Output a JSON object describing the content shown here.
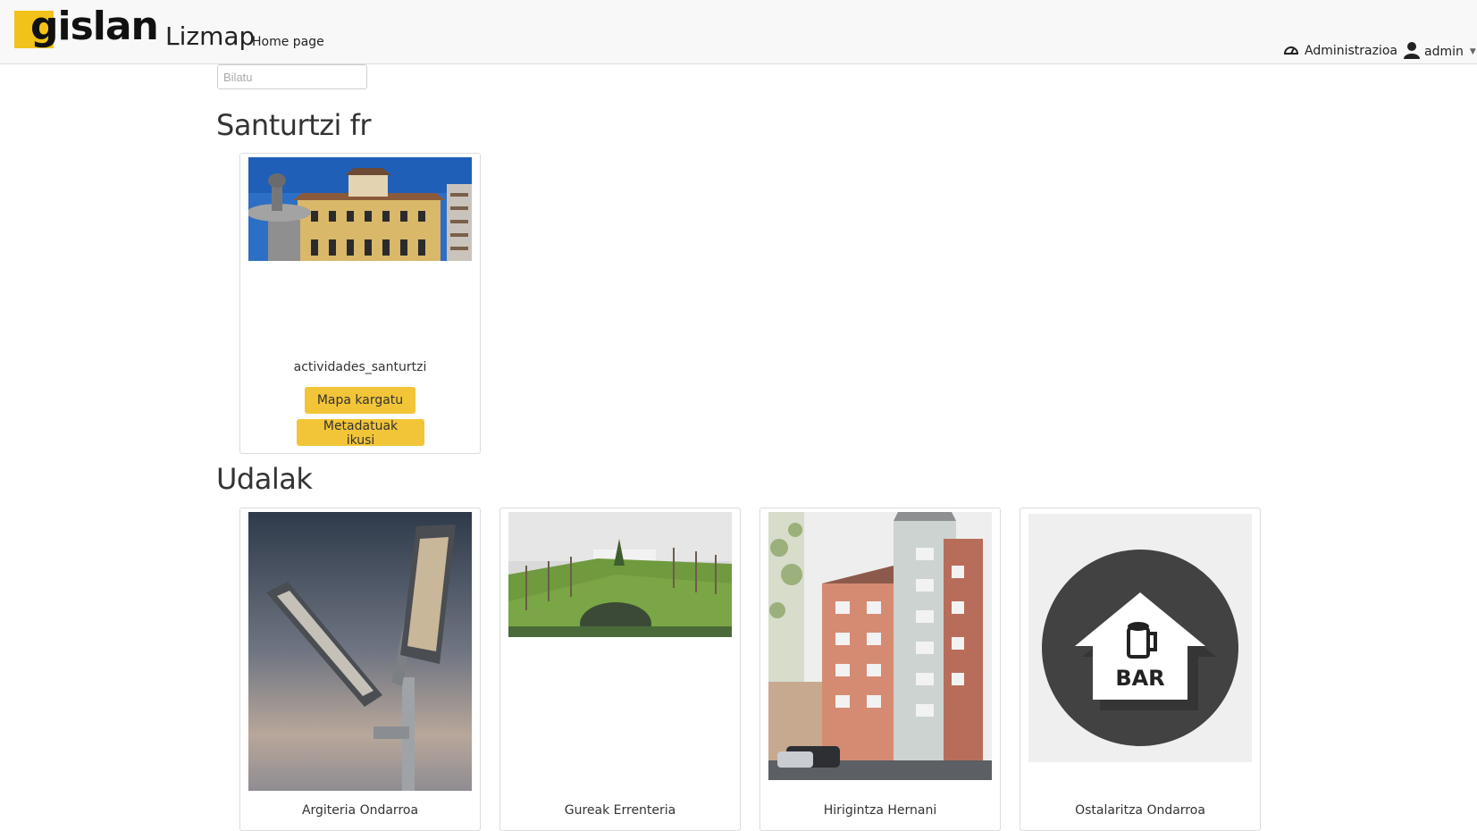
{
  "header": {
    "logo_text": "gislan",
    "app_title": "Lizmap",
    "home_link": "Home page",
    "admin_link": "Administrazioa",
    "user_name": "admin"
  },
  "search": {
    "placeholder": "Bilatu"
  },
  "sections": [
    {
      "title": "Santurtzi fr",
      "projects": [
        {
          "name": "actividades_santurtzi",
          "load_button": "Mapa kargatu",
          "metadata_button": "Metadatuak ikusi"
        }
      ]
    },
    {
      "title": "Udalak",
      "projects": [
        {
          "name": "Argiteria Ondarroa"
        },
        {
          "name": "Gureak Errenteria"
        },
        {
          "name": "Hirigintza Hernani"
        },
        {
          "name": "Ostalaritza Ondarroa",
          "thumb_text": "BAR"
        }
      ]
    }
  ],
  "colors": {
    "accent": "#f2c538",
    "logo": "#f2c21b"
  },
  "icons": [
    "dashboard-icon",
    "user-icon",
    "caret-down-icon"
  ]
}
